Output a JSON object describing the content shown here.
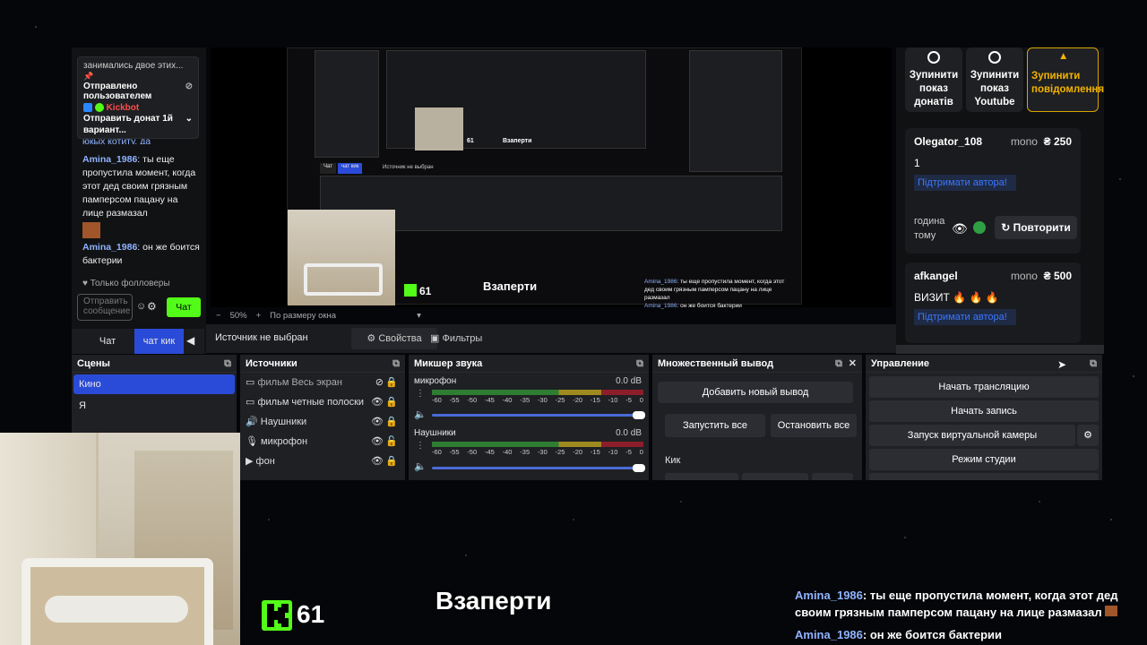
{
  "chat": {
    "pinned_top": "занимались двое этих...",
    "pinned_sent_by": "Отправлено пользователем",
    "pinned_user": "Kickbot",
    "pinned_text": "Отправить донат 1й вариант...",
    "partial_line": "юкых котиту. да",
    "messages": [
      {
        "user": "Amina_1986",
        "text": "ты еще пропустила момент, когда этот дед своим грязным памперсом пацану на лице размазал"
      },
      {
        "user": "Amina_1986",
        "text": "он же боится бактерии"
      }
    ],
    "followers_only": "Только фолловеры",
    "input_placeholder": "Отправить сообщение",
    "send_label": "Чат"
  },
  "nested_preview": {
    "tabs": [
      "Чат",
      "чат кик"
    ],
    "status": "Источник не выбран",
    "kick_count": "61",
    "title": "Взаперти"
  },
  "preview_bar": {
    "zoom": "50%",
    "fit": "По размеру окна"
  },
  "dono": {
    "stop_buttons": [
      "Зупинити показ донатів",
      "Зупинити показ Youtube",
      "Зупинити повідомлення"
    ],
    "cards": [
      {
        "user": "Olegator_108",
        "currency": "mono",
        "amount": "₴ 250",
        "message": "1",
        "support": "Підтримати автора!",
        "time": "година тому",
        "repeat": "Повторити"
      },
      {
        "user": "afkangel",
        "currency": "mono",
        "amount": "₴ 500",
        "message": "ВИЗИТ 🔥 🔥 🔥",
        "support": "Підтримати автора!"
      }
    ]
  },
  "tabs": {
    "chat": "Чат",
    "chat_kick": "чат кик"
  },
  "toolbar": {
    "source_status": "Источник не выбран",
    "properties": "Свойства",
    "filters": "Фильтры"
  },
  "scenes": {
    "title": "Сцены",
    "items": [
      "Кино",
      "Я"
    ]
  },
  "sources": {
    "title": "Источники",
    "items": [
      "фильм Весь экран",
      "фильм четные полоски",
      "Наушники",
      "микрофон",
      "фон"
    ]
  },
  "mixer": {
    "title": "Микшер звука",
    "channels": [
      {
        "name": "микрофон",
        "db": "0.0 dB"
      },
      {
        "name": "Наушники",
        "db": "0.0 dB"
      }
    ],
    "ticks": [
      "-60",
      "-55",
      "-50",
      "-45",
      "-40",
      "-35",
      "-30",
      "-25",
      "-20",
      "-15",
      "-10",
      "-5",
      "0"
    ]
  },
  "multi": {
    "title": "Множественный вывод",
    "add": "Добавить новый вывод",
    "start_all": "Запустить все",
    "stop_all": "Остановить все",
    "kick": "Кик"
  },
  "controls": {
    "title": "Управление",
    "start_stream": "Начать трансляцию",
    "start_record": "Начать запись",
    "virtual_cam": "Запуск виртуальной камеры",
    "studio": "Режим студии"
  },
  "overlay": {
    "kick_count": "61",
    "title": "Взаперти",
    "messages": [
      {
        "user": "Amina_1986",
        "text": "ты еще пропустила момент, когда этот дед своим грязным памперсом пацану на лице размазал"
      },
      {
        "user": "Amina_1986",
        "text": "он же боится бактерии"
      }
    ]
  },
  "colors": {
    "kick_green": "#53fc18",
    "accent_blue": "#2a4bd7",
    "dono_link": "#3a78ff"
  }
}
